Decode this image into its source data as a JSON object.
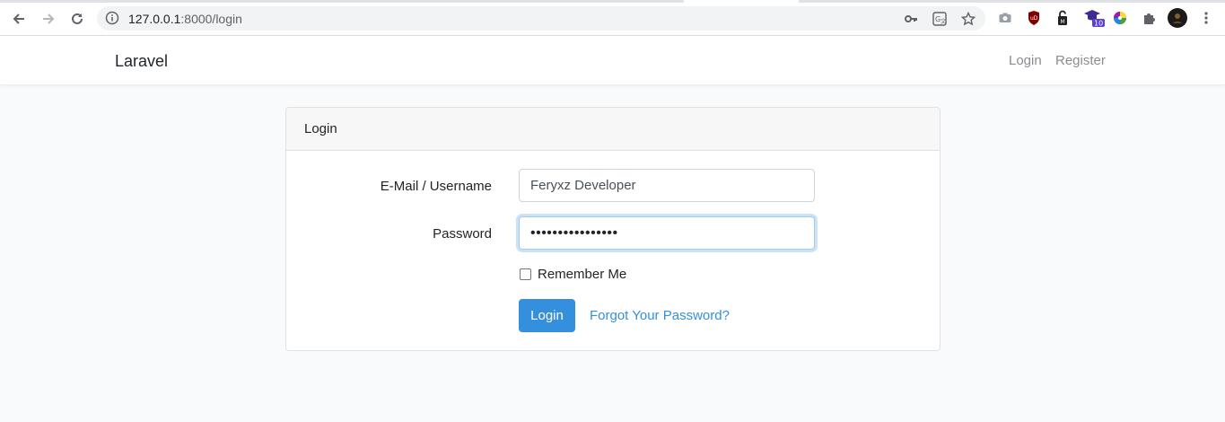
{
  "browser": {
    "url_host": "127.0.0.1",
    "url_path": ":8000/login",
    "badge_count": "10"
  },
  "navbar": {
    "brand": "Laravel",
    "links": [
      "Login",
      "Register"
    ]
  },
  "card": {
    "header": "Login",
    "email_label": "E-Mail / Username",
    "email_value": "Feryxz Developer",
    "password_label": "Password",
    "password_value": "••••••••••••••••",
    "remember_label": "Remember Me",
    "submit_label": "Login",
    "forgot_label": "Forgot Your Password?"
  },
  "colors": {
    "primary": "#3490dc",
    "page_bg": "#f8fafc"
  }
}
